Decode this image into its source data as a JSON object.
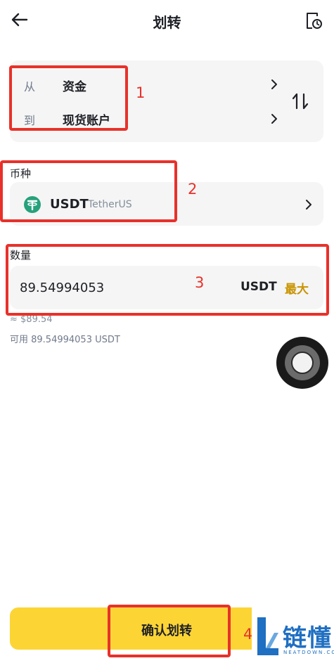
{
  "header": {
    "title": "划转",
    "back_icon": "arrow-left-icon",
    "history_icon": "history-record-icon"
  },
  "transfer": {
    "from_label": "从",
    "from_value": "资金",
    "to_label": "到",
    "to_value": "现货账户",
    "swap_icon": "swap-arrows-icon"
  },
  "coin": {
    "section_label": "币种",
    "symbol": "USDT",
    "name": "TetherUS",
    "logo_color": "#26a17b"
  },
  "amount": {
    "section_label": "数量",
    "value": "89.54994053",
    "unit": "USDT",
    "max_label": "最大",
    "approx": "≈ $89.54",
    "available": "可用 89.54994053 USDT"
  },
  "confirm": {
    "label": "确认划转"
  },
  "annotations": {
    "n1": "1",
    "n2": "2",
    "n3": "3",
    "n4": "4"
  },
  "watermark": {
    "text": "链懂",
    "sub": "NEATDOWN.COM"
  },
  "colors": {
    "accent_yellow": "#fcd535",
    "max_text": "#c99400",
    "card_bg": "#f5f5f5",
    "annotation_red": "#e8312a"
  }
}
